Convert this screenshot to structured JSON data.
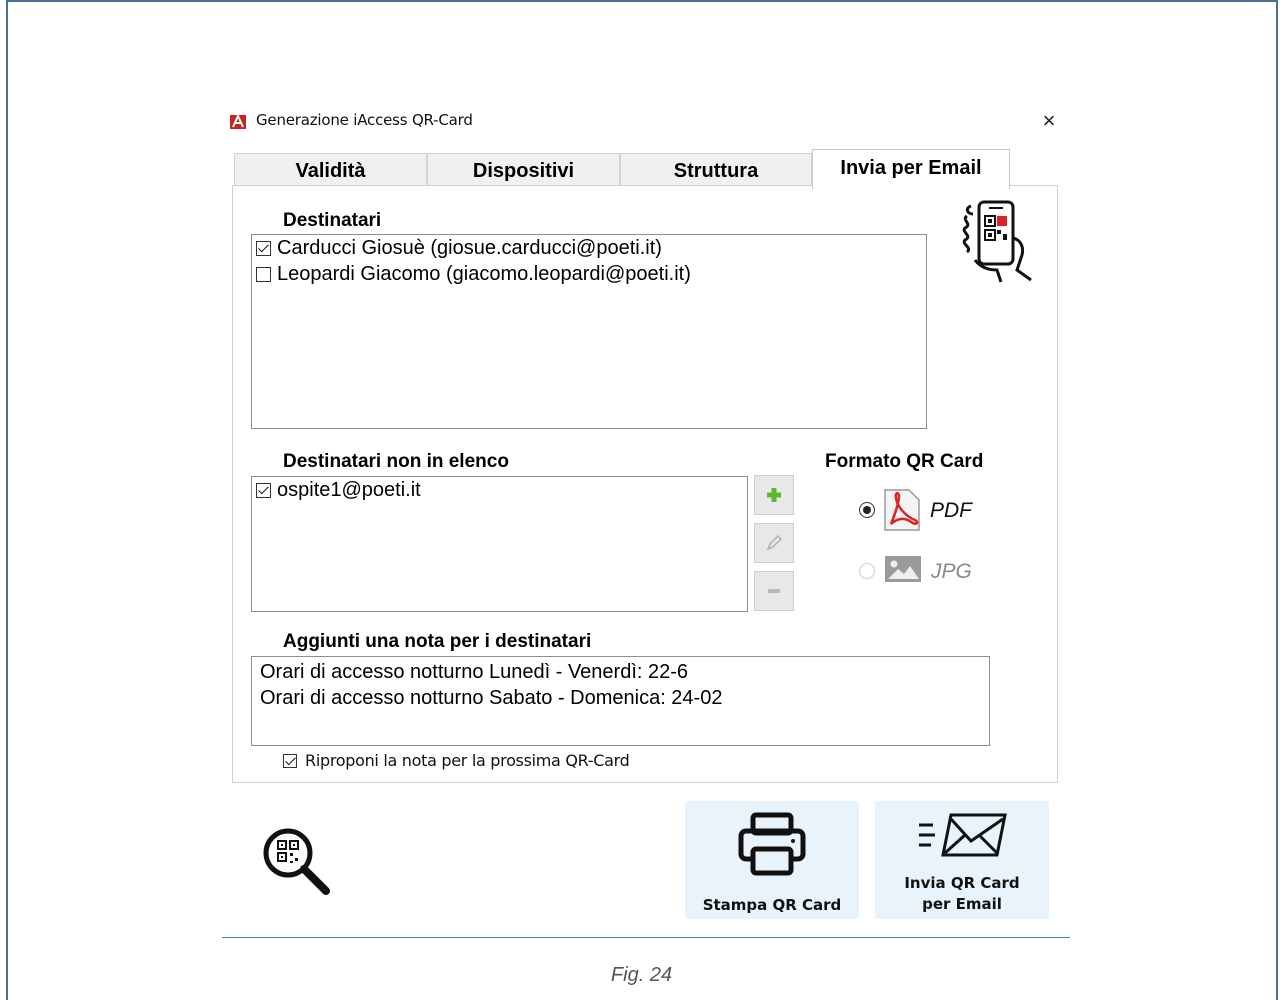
{
  "window": {
    "title": "Generazione iAccess QR-Card",
    "close_glyph": "×"
  },
  "tabs": [
    {
      "label": "Validità",
      "active": false
    },
    {
      "label": "Dispositivi",
      "active": false
    },
    {
      "label": "Struttura",
      "active": false
    },
    {
      "label": "Invia per Email",
      "active": true
    }
  ],
  "recipients": {
    "label": "Destinatari",
    "items": [
      {
        "text": "Carducci Giosuè (giosue.carducci@poeti.it)",
        "checked": true
      },
      {
        "text": "Leopardi Giacomo (giacomo.leopardi@poeti.it)",
        "checked": false
      }
    ]
  },
  "extra_recipients": {
    "label": "Destinatari non in elenco",
    "items": [
      {
        "text": "ospite1@poeti.it",
        "checked": true
      }
    ],
    "buttons": [
      "add-icon",
      "edit-icon",
      "remove-icon"
    ]
  },
  "format": {
    "label": "Formato QR Card",
    "options": [
      {
        "label": "PDF",
        "selected": true,
        "enabled": true,
        "icon": "pdf-icon"
      },
      {
        "label": "JPG",
        "selected": false,
        "enabled": false,
        "icon": "image-icon"
      }
    ]
  },
  "note": {
    "label": "Aggiunti una nota per i destinatari",
    "lines": [
      "Orari di accesso notturno Lunedì - Venerdì: 22-6",
      "Orari di accesso notturno Sabato - Domenica: 24-02"
    ],
    "repropose_label": "Riproponi la nota per la prossima QR-Card",
    "repropose_checked": true
  },
  "actions": {
    "print_label": "Stampa QR Card",
    "email_label_line1": "Invia QR Card",
    "email_label_line2": "per Email"
  },
  "caption": "Fig. 24",
  "colors": {
    "frame": "#4a6f96",
    "action_button_bg": "#e9f3fb",
    "caption_rule": "#2f87cf",
    "pdf_red": "#d22"
  }
}
